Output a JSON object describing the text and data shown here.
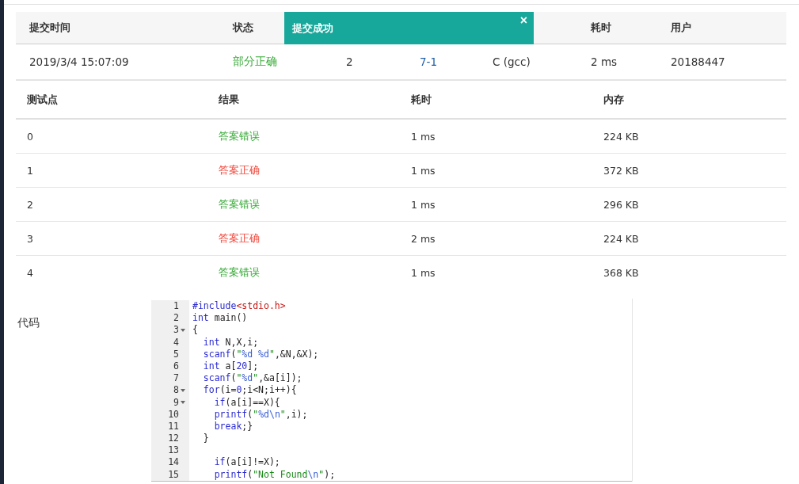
{
  "submission": {
    "columns_left": [
      "提交时间",
      "状态"
    ],
    "columns_right": [
      "耗时",
      "用户"
    ],
    "row": {
      "time": "2019/3/4 15:07:09",
      "status": "部分正确",
      "score": "2",
      "problem": "7-1",
      "compiler": "C (gcc)",
      "duration": "2 ms",
      "user": "20188447"
    }
  },
  "toast": {
    "title": "提交成功",
    "close": "×"
  },
  "tests": {
    "columns": [
      "测试点",
      "结果",
      "耗时",
      "内存"
    ],
    "rows": [
      {
        "id": "0",
        "result": "答案错误",
        "color": "#3aab3a",
        "time": "1 ms",
        "memory": "224 KB"
      },
      {
        "id": "1",
        "result": "答案正确",
        "color": "#f2463a",
        "time": "1 ms",
        "memory": "372 KB"
      },
      {
        "id": "2",
        "result": "答案错误",
        "color": "#3aab3a",
        "time": "1 ms",
        "memory": "296 KB"
      },
      {
        "id": "3",
        "result": "答案正确",
        "color": "#f2463a",
        "time": "2 ms",
        "memory": "224 KB"
      },
      {
        "id": "4",
        "result": "答案错误",
        "color": "#3aab3a",
        "time": "1 ms",
        "memory": "368 KB"
      }
    ]
  },
  "code": {
    "label": "代码",
    "lines": [
      {
        "number": "1",
        "tokens": [
          {
            "kind": "keyword",
            "text": "#include"
          },
          {
            "kind": "header",
            "text": "<stdio.h>"
          }
        ]
      },
      {
        "number": "2",
        "tokens": [
          {
            "kind": "keyword",
            "text": "int"
          },
          {
            "kind": "plain",
            "text": " main()"
          }
        ]
      },
      {
        "number": "3",
        "foldable": true,
        "tokens": [
          {
            "kind": "plain",
            "text": "{"
          }
        ]
      },
      {
        "number": "4",
        "tokens": [
          {
            "kind": "keyword",
            "text": "  int"
          },
          {
            "kind": "plain",
            "text": " N,X,i;"
          }
        ]
      },
      {
        "number": "5",
        "tokens": [
          {
            "kind": "keyword",
            "text": "  scanf"
          },
          {
            "kind": "plain",
            "text": "("
          },
          {
            "kind": "string",
            "text": "\""
          },
          {
            "kind": "format",
            "text": "%d %d"
          },
          {
            "kind": "string",
            "text": "\""
          },
          {
            "kind": "plain",
            "text": ",&N,&X);"
          }
        ]
      },
      {
        "number": "6",
        "tokens": [
          {
            "kind": "keyword",
            "text": "  int"
          },
          {
            "kind": "plain",
            "text": " a["
          },
          {
            "kind": "number",
            "text": "20"
          },
          {
            "kind": "plain",
            "text": "];"
          }
        ]
      },
      {
        "number": "7",
        "tokens": [
          {
            "kind": "keyword",
            "text": "  scanf"
          },
          {
            "kind": "plain",
            "text": "("
          },
          {
            "kind": "string",
            "text": "\""
          },
          {
            "kind": "format",
            "text": "%d"
          },
          {
            "kind": "string",
            "text": "\""
          },
          {
            "kind": "plain",
            "text": ",&a[i]);"
          }
        ]
      },
      {
        "number": "8",
        "foldable": true,
        "tokens": [
          {
            "kind": "keyword",
            "text": "  for"
          },
          {
            "kind": "plain",
            "text": "(i="
          },
          {
            "kind": "number",
            "text": "0"
          },
          {
            "kind": "plain",
            "text": ";i<N;i++){"
          }
        ]
      },
      {
        "number": "9",
        "foldable": true,
        "tokens": [
          {
            "kind": "keyword",
            "text": "    if"
          },
          {
            "kind": "plain",
            "text": "(a[i]==X){"
          }
        ]
      },
      {
        "number": "10",
        "tokens": [
          {
            "kind": "keyword",
            "text": "    printf"
          },
          {
            "kind": "plain",
            "text": "("
          },
          {
            "kind": "string",
            "text": "\""
          },
          {
            "kind": "format",
            "text": "%d\\n"
          },
          {
            "kind": "string",
            "text": "\""
          },
          {
            "kind": "plain",
            "text": ",i);"
          }
        ]
      },
      {
        "number": "11",
        "tokens": [
          {
            "kind": "keyword",
            "text": "    break"
          },
          {
            "kind": "plain",
            "text": ";}"
          }
        ]
      },
      {
        "number": "12",
        "tokens": [
          {
            "kind": "plain",
            "text": "  }"
          }
        ]
      },
      {
        "number": "13"
      },
      {
        "number": "14",
        "tokens": [
          {
            "kind": "keyword",
            "text": "    if"
          },
          {
            "kind": "plain",
            "text": "(a[i]!=X);"
          }
        ]
      },
      {
        "number": "15",
        "tokens": [
          {
            "kind": "keyword",
            "text": "    printf"
          },
          {
            "kind": "plain",
            "text": "("
          },
          {
            "kind": "string",
            "text": "\"Not Found"
          },
          {
            "kind": "format",
            "text": "\\n"
          },
          {
            "kind": "string",
            "text": "\""
          },
          {
            "kind": "plain",
            "text": ");"
          }
        ]
      }
    ]
  }
}
